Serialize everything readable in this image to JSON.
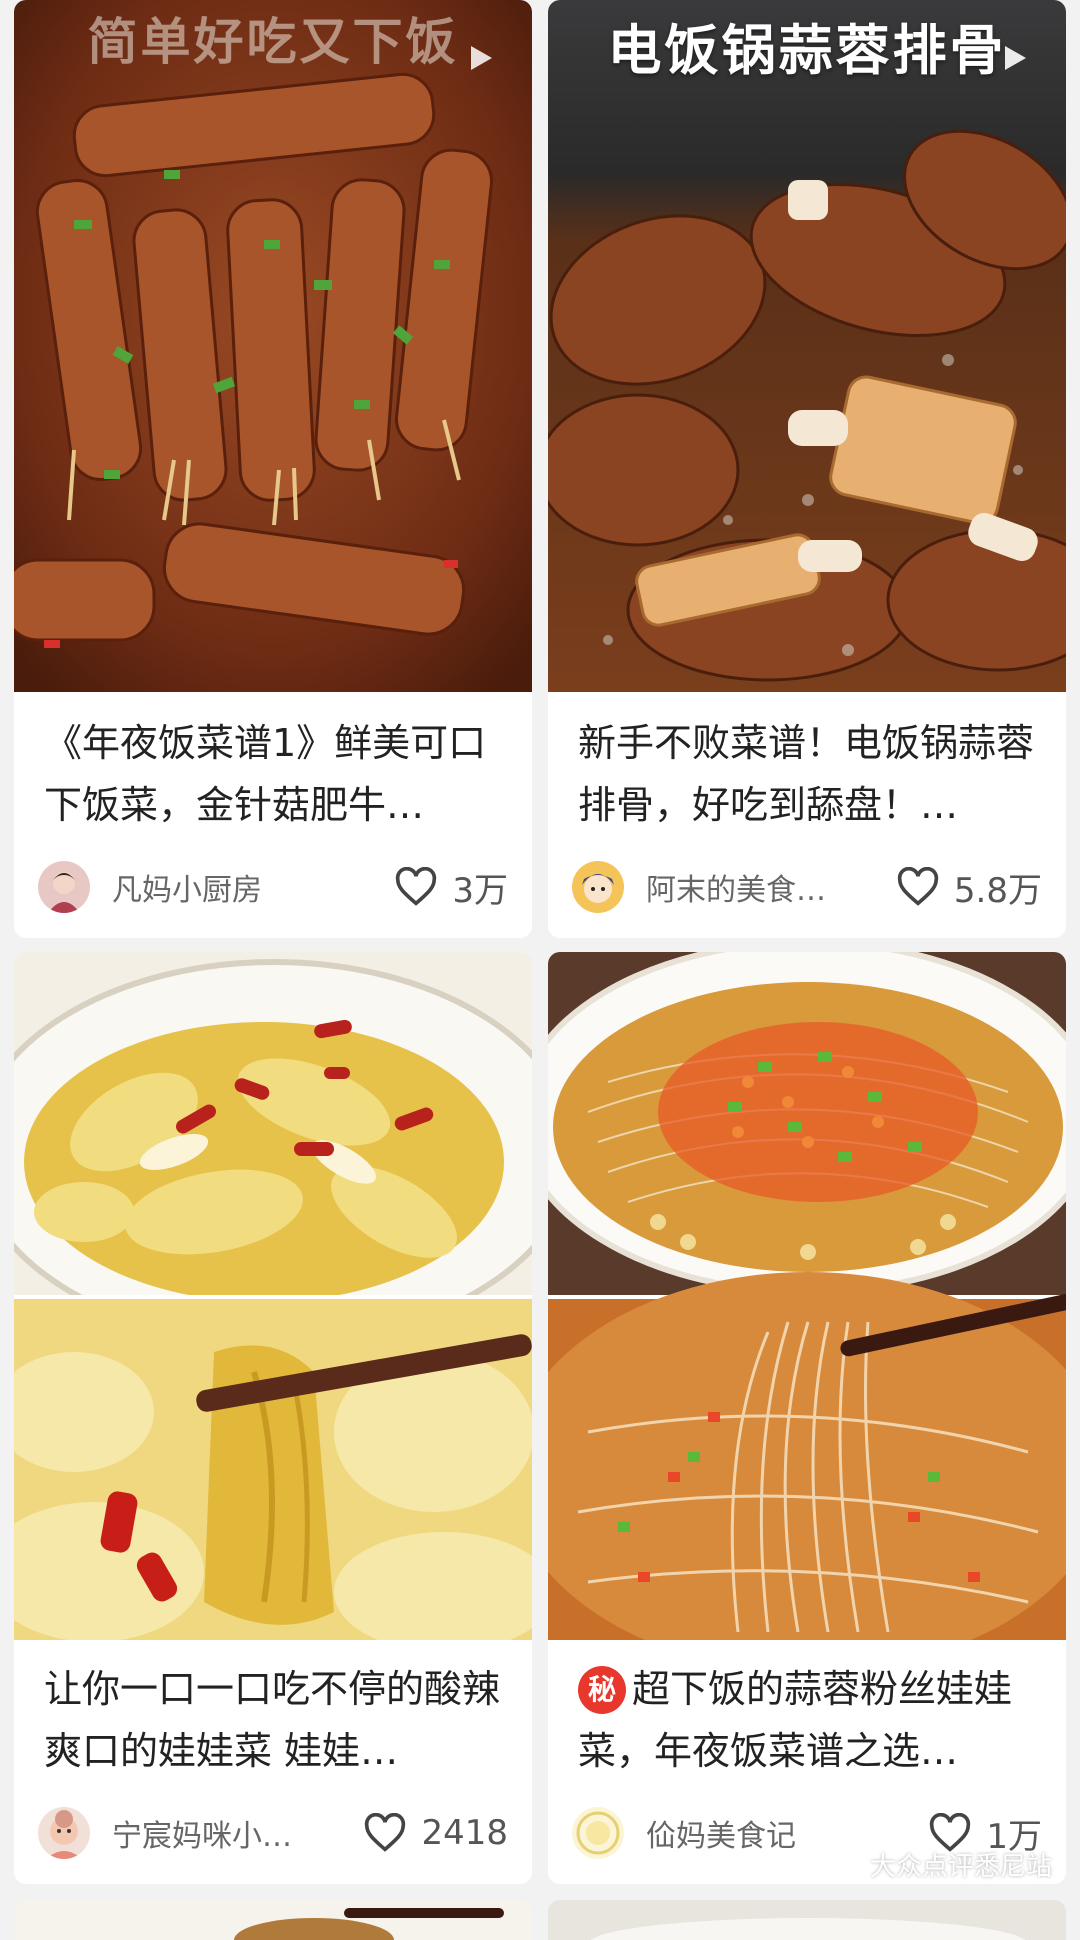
{
  "feed": {
    "cards": [
      {
        "photo_caption": "简单好吃又下饭",
        "title": "《年夜饭菜谱1》鲜美可口下饭菜，金针菇肥牛…",
        "author": "凡妈小厨房",
        "likes": "3万",
        "has_video": true
      },
      {
        "photo_caption": "电饭锅蒜蓉排骨",
        "title": "新手不败菜谱！电饭锅蒜蓉排骨，好吃到舔盘！…",
        "author": "阿末的美食…",
        "likes": "5.8万",
        "has_video": true
      },
      {
        "title": "让你一口一口吃不停的酸辣爽口的娃娃菜 娃娃…",
        "author": "宁宸妈咪小…",
        "likes": "2418"
      },
      {
        "badge": "秘",
        "title": "超下饭的蒜蓉粉丝娃娃菜，年夜饭菜谱之选…",
        "author": "佡妈美食记",
        "likes": "1万"
      }
    ]
  },
  "watermark": {
    "text": "大众点评悉尼站",
    "icon": "wechat-icon"
  },
  "colors": {
    "background": "#f2f2f2",
    "card": "#ffffff",
    "badge": "#e8382e"
  }
}
